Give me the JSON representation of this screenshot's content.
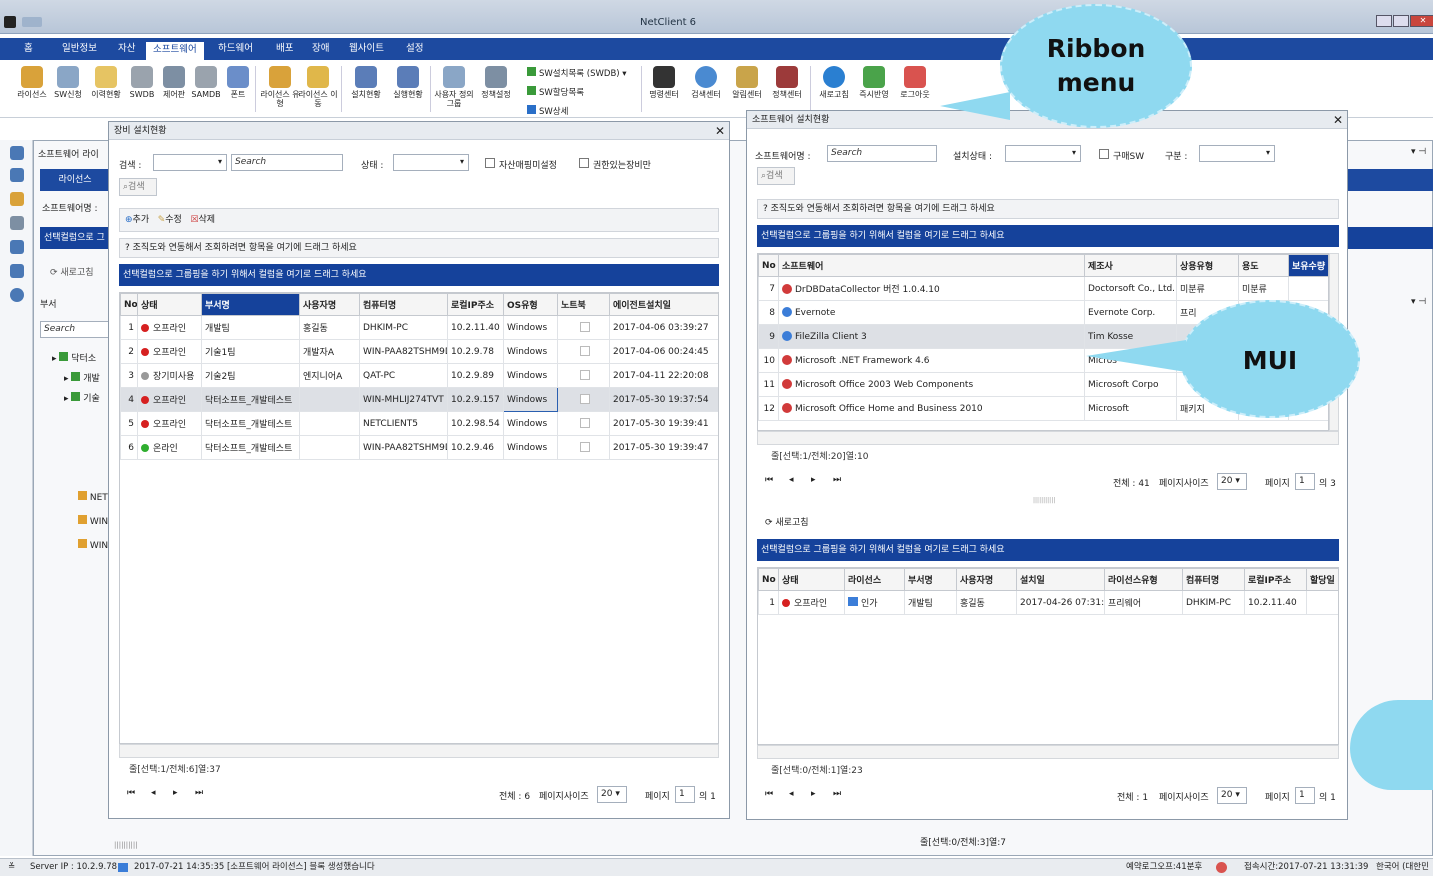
{
  "window": {
    "title": "NetClient 6"
  },
  "menu": {
    "items": [
      "홈",
      "일반정보",
      "자산",
      "소프트웨어",
      "하드웨어",
      "배포",
      "장애",
      "웹사이트",
      "설정"
    ],
    "active": 3
  },
  "ribbon": {
    "buttons": [
      {
        "label": "라이선스",
        "icon": "key-icon"
      },
      {
        "label": "SW신청",
        "icon": "sw-request-icon"
      },
      {
        "label": "이력현황",
        "icon": "history-icon"
      },
      {
        "label": "SWDB",
        "icon": "swdb-icon"
      },
      {
        "label": "제어판",
        "icon": "control-panel-icon"
      },
      {
        "label": "SAMDB",
        "icon": "samdb-icon"
      },
      {
        "label": "폰트",
        "icon": "font-icon"
      },
      {
        "label": "라이선스 유형",
        "icon": "license-type-icon"
      },
      {
        "label": "라이선스 이동",
        "icon": "license-move-icon"
      },
      {
        "label": "설치현황",
        "icon": "install-status-icon"
      },
      {
        "label": "실행현황",
        "icon": "run-status-icon"
      },
      {
        "label": "사용자 정의그룹",
        "icon": "user-group-icon"
      },
      {
        "label": "정책설정",
        "icon": "policy-icon"
      }
    ],
    "small_buttons": [
      "SW설치목록 (SWDB)",
      "SW할당목록",
      "SW상세"
    ],
    "buttons2": [
      {
        "label": "명령센터",
        "icon": "command-center-icon"
      },
      {
        "label": "검색센터",
        "icon": "search-center-icon"
      },
      {
        "label": "알림센터",
        "icon": "notification-center-icon"
      },
      {
        "label": "정책센터",
        "icon": "policy-center-icon"
      },
      {
        "label": "새로고침",
        "icon": "refresh-icon"
      },
      {
        "label": "즉시반영",
        "icon": "apply-now-icon"
      },
      {
        "label": "로그아웃",
        "icon": "logout-icon"
      }
    ]
  },
  "callouts": {
    "ribbon": "Ribbon\nmenu",
    "mui": "MUI"
  },
  "background_panel": {
    "title": "소프트웨어 라이",
    "license_tab": "라이선스",
    "sw_name_label": "소프트웨어명 :",
    "group_bar": "선택컬럼으로 그",
    "refresh": "새로고침",
    "dept_label": "부서",
    "search_placeholder": "Search",
    "tree": [
      "닥터소",
      "개발",
      "기술",
      "NET",
      "WIN",
      "WIN"
    ],
    "footer": "줄[선택:0/전체:3]열:7",
    "scroll_mark": "||||||||||"
  },
  "left_dialog": {
    "title": "장비 설치현황",
    "search_label": "검색 :",
    "search_placeholder": "Search",
    "status_label": "상태 :",
    "check_asset": "자산매핑미설정",
    "check_permission": "권한있는장비만",
    "search_button": "검색",
    "add": "추가",
    "edit": "수정",
    "delete": "삭제",
    "org_drag": "조직도와 연동해서 조회하려면 항목을 여기에 드래그 하세요",
    "group_drag": "선택컬럼으로 그룹핑을 하기 위해서 컬럼을 여기로 드래그 하세요",
    "columns": [
      "No",
      "상태",
      "부서명",
      "사용자명",
      "컴퓨터명",
      "로컬IP주소",
      "OS유형",
      "노트북",
      "에이전트설치일"
    ],
    "rows": [
      {
        "no": "1",
        "status": "오프라인",
        "status_color": "#d62020",
        "dept": "개발팀",
        "user": "홍길동",
        "pc": "DHKIM-PC",
        "ip": "10.2.11.40",
        "os": "Windows",
        "date": "2017-04-06 03:39:27"
      },
      {
        "no": "2",
        "status": "오프라인",
        "status_color": "#d62020",
        "dept": "기술1팀",
        "user": "개발자A",
        "pc": "WIN-PAA82TSHM9D",
        "ip": "10.2.9.78",
        "os": "Windows",
        "date": "2017-04-06 00:24:45"
      },
      {
        "no": "3",
        "status": "장기미사용",
        "status_color": "#999999",
        "dept": "기술2팀",
        "user": "엔지니어A",
        "pc": "QAT-PC",
        "ip": "10.2.9.89",
        "os": "Windows",
        "date": "2017-04-11 22:20:08"
      },
      {
        "no": "4",
        "status": "오프라인",
        "status_color": "#d62020",
        "dept": "닥터소프트_개발테스트",
        "user": "",
        "pc": "WIN-MHLIJ274TVT",
        "ip": "10.2.9.157",
        "os": "Windows",
        "date": "2017-05-30 19:37:54"
      },
      {
        "no": "5",
        "status": "오프라인",
        "status_color": "#d62020",
        "dept": "닥터소프트_개발테스트",
        "user": "",
        "pc": "NETCLIENT5",
        "ip": "10.2.98.54",
        "os": "Windows",
        "date": "2017-05-30 19:39:41"
      },
      {
        "no": "6",
        "status": "온라인",
        "status_color": "#2fae2f",
        "dept": "닥터소프트_개발테스트",
        "user": "",
        "pc": "WIN-PAA82TSHM9D",
        "ip": "10.2.9.46",
        "os": "Windows",
        "date": "2017-05-30 19:39:47"
      }
    ],
    "footer": "줄[선택:1/전체:6]열:37",
    "total": "전체 : 6",
    "page_size_label": "페이지사이즈",
    "page_size": "20",
    "page_label": "페이지",
    "page": "1",
    "page_of": "의 1"
  },
  "right_dialog": {
    "title": "소프트웨어 설치현황",
    "sw_label": "소프트웨어명 :",
    "search_placeholder": "Search",
    "install_status_label": "설치상태 :",
    "check_purchase": "구매SW",
    "category_label": "구분 :",
    "search_button": "검색",
    "org_drag": "조직도와 연동해서 조회하려면 항목을 여기에 드래그 하세요",
    "group_drag": "선택컬럼으로 그룹핑을 하기 위해서 컬럼을 여기로 드래그 하세요",
    "columns": [
      "No",
      "소프트웨어",
      "제조사",
      "상용유형",
      "용도",
      "보유수량"
    ],
    "rows": [
      {
        "no": "7",
        "name": "DrDBDataCollector 버전 1.0.4.10",
        "icon_color": "#d13a3a",
        "maker": "Doctorsoft Co., Ltd.",
        "type": "미분류",
        "use": "미분류"
      },
      {
        "no": "8",
        "name": "Evernote",
        "icon_color": "#3b7dd8",
        "maker": "Evernote Corp.",
        "type": "프리",
        "use": ""
      },
      {
        "no": "9",
        "name": "FileZilla Client 3",
        "icon_color": "#3b7dd8",
        "maker": "Tim Kosse",
        "type": "",
        "use": ""
      },
      {
        "no": "10",
        "name": "Microsoft .NET Framework 4.6",
        "icon_color": "#d13a3a",
        "maker": "Micros",
        "type": "",
        "use": ""
      },
      {
        "no": "11",
        "name": "Microsoft Office 2003 Web Components",
        "icon_color": "#d13a3a",
        "maker": "Microsoft Corpo",
        "type": "",
        "use": ""
      },
      {
        "no": "12",
        "name": "Microsoft Office Home and Business 2010",
        "icon_color": "#d13a3a",
        "maker": "Microsoft",
        "type": "패키지",
        "use": ""
      }
    ],
    "footer": "줄[선택:1/전체:20]열:10",
    "total": "전체 : 41",
    "page_size_label": "페이지사이즈",
    "page_size": "20",
    "page_label": "페이지",
    "page": "1",
    "page_of": "의 3",
    "divider_mark": "|||||||||||",
    "refresh": "새로고침",
    "group_drag2": "선택컬럼으로 그룹핑을 하기 위해서 컬럼을 여기로 드래그 하세요",
    "columns2": [
      "No",
      "상태",
      "라이선스",
      "부서명",
      "사용자명",
      "설치일",
      "라이선스유형",
      "컴퓨터명",
      "로컬IP주소",
      "할당일"
    ],
    "rows2": [
      {
        "no": "1",
        "status": "오프라인",
        "license": "인가",
        "dept": "개발팀",
        "user": "홍길동",
        "date": "2017-04-26 07:31:51",
        "ltype": "프리웨어",
        "pc": "DHKIM-PC",
        "ip": "10.2.11.40",
        "assign": ""
      }
    ],
    "footer2": "줄[선택:0/전체:1]열:23",
    "total2": "전체 : 1",
    "page2": "1",
    "page_of2": "의 1"
  },
  "status_bar": {
    "server": "Server IP : 10.2.9.78",
    "message": "2017-07-21 14:35:35  [소프트웨어 라이선스] 블록 생성했습니다",
    "right1": "예약로그오프:41분후",
    "right2": "접속시간:2017-07-21 13:31:39",
    "right3": "한국어 (대한민"
  }
}
